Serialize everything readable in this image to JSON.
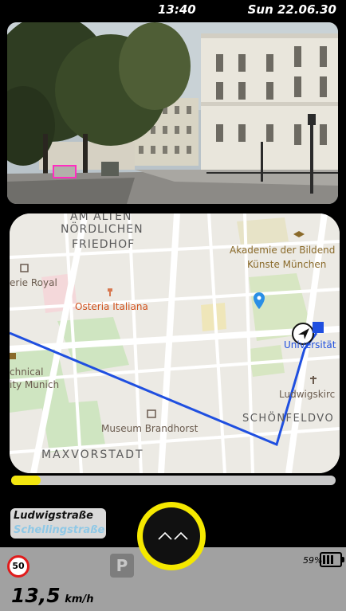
{
  "status_bar": {
    "time": "13:40",
    "date": "Sun 22.06.30"
  },
  "camera_view": {
    "icon": "camera-feed-image"
  },
  "map": {
    "labels": {
      "am_alten": "AM ALTEN",
      "noerdlichen": "NÖRDLICHEN",
      "friedhof": "FRIEDHOF",
      "akademie_1": "Akademie der Bildend",
      "akademie_2": "Künste München",
      "erie_royal": "erie Royal",
      "osteria": "Osteria Italiana",
      "universitaet": "Universität",
      "chnical": "chnical",
      "ity_munich": "ity Munich",
      "ludwigskirch": "Ludwigskirc",
      "schoenfeld": "SCHÖNFELDVO",
      "museum": "Museum Brandhorst",
      "maxvorstadt": "MAXVORSTADT"
    },
    "route_color": "#1f4fe0"
  },
  "route_progress": {
    "fraction": 0.09,
    "color": "#f3e60f"
  },
  "streets": {
    "current": "Ludwigstraße",
    "next": "Schellingstraße"
  },
  "menu_button": {
    "icon": "double-chevron-up-icon",
    "ring_color": "#f5e800"
  },
  "bottom_panel": {
    "speed_limit": "50",
    "parking_letter": "P",
    "battery_percent": "59%",
    "speed_value": "13,5",
    "speed_unit": "km/h"
  }
}
